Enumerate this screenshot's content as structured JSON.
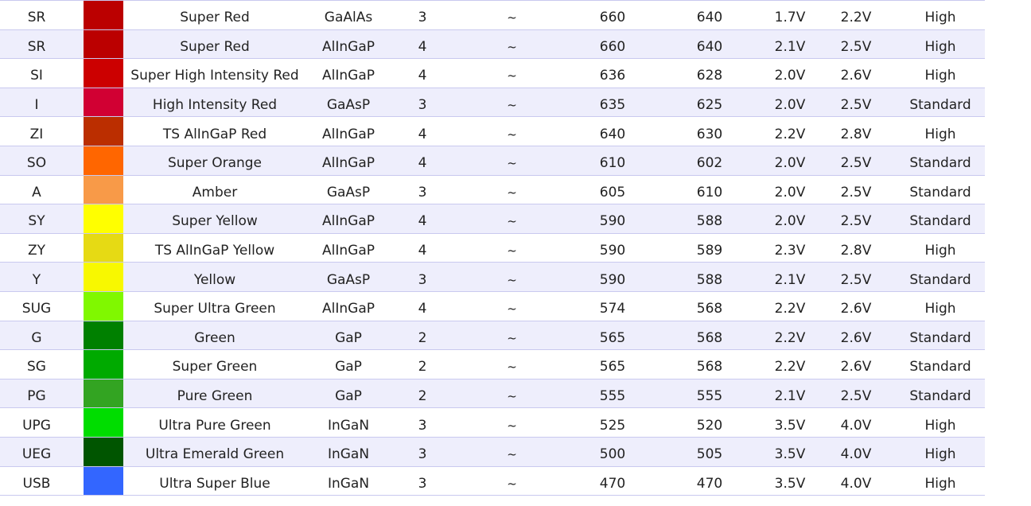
{
  "table": {
    "rows": [
      {
        "code": "SR",
        "color": "#bb0000",
        "name": "Super Red",
        "material": "GaAlAs",
        "size": "3",
        "angle": "~",
        "peak_nm": "660",
        "dominant_nm": "640",
        "vf_typ": "1.7V",
        "vf_max": "2.2V",
        "intensity": "High"
      },
      {
        "code": "SR",
        "color": "#bb0000",
        "name": "Super Red",
        "material": "AlInGaP",
        "size": "4",
        "angle": "~",
        "peak_nm": "660",
        "dominant_nm": "640",
        "vf_typ": "2.1V",
        "vf_max": "2.5V",
        "intensity": "High"
      },
      {
        "code": "SI",
        "color": "#cc0000",
        "name": "Super High Intensity Red",
        "material": "AlInGaP",
        "size": "4",
        "angle": "~",
        "peak_nm": "636",
        "dominant_nm": "628",
        "vf_typ": "2.0V",
        "vf_max": "2.6V",
        "intensity": "High"
      },
      {
        "code": "I",
        "color": "#d10033",
        "name": "High Intensity Red",
        "material": "GaAsP",
        "size": "3",
        "angle": "~",
        "peak_nm": "635",
        "dominant_nm": "625",
        "vf_typ": "2.0V",
        "vf_max": "2.5V",
        "intensity": "Standard"
      },
      {
        "code": "ZI",
        "color": "#bb2e00",
        "name": "TS AlInGaP Red",
        "material": "AlInGaP",
        "size": "4",
        "angle": "~",
        "peak_nm": "640",
        "dominant_nm": "630",
        "vf_typ": "2.2V",
        "vf_max": "2.8V",
        "intensity": "High"
      },
      {
        "code": "SO",
        "color": "#ff6600",
        "name": "Super Orange",
        "material": "AlInGaP",
        "size": "4",
        "angle": "~",
        "peak_nm": "610",
        "dominant_nm": "602",
        "vf_typ": "2.0V",
        "vf_max": "2.5V",
        "intensity": "Standard"
      },
      {
        "code": "A",
        "color": "#f89a48",
        "name": "Amber",
        "material": "GaAsP",
        "size": "3",
        "angle": "~",
        "peak_nm": "605",
        "dominant_nm": "610",
        "vf_typ": "2.0V",
        "vf_max": "2.5V",
        "intensity": "Standard"
      },
      {
        "code": "SY",
        "color": "#ffff00",
        "name": "Super Yellow",
        "material": "AlInGaP",
        "size": "4",
        "angle": "~",
        "peak_nm": "590",
        "dominant_nm": "588",
        "vf_typ": "2.0V",
        "vf_max": "2.5V",
        "intensity": "Standard"
      },
      {
        "code": "ZY",
        "color": "#e6da14",
        "name": "TS AlInGaP Yellow",
        "material": "AlInGaP",
        "size": "4",
        "angle": "~",
        "peak_nm": "590",
        "dominant_nm": "589",
        "vf_typ": "2.3V",
        "vf_max": "2.8V",
        "intensity": "High"
      },
      {
        "code": "Y",
        "color": "#f8f800",
        "name": "Yellow",
        "material": "GaAsP",
        "size": "3",
        "angle": "~",
        "peak_nm": "590",
        "dominant_nm": "588",
        "vf_typ": "2.1V",
        "vf_max": "2.5V",
        "intensity": "Standard"
      },
      {
        "code": "SUG",
        "color": "#80f800",
        "name": "Super Ultra Green",
        "material": "AlInGaP",
        "size": "4",
        "angle": "~",
        "peak_nm": "574",
        "dominant_nm": "568",
        "vf_typ": "2.2V",
        "vf_max": "2.6V",
        "intensity": "High"
      },
      {
        "code": "G",
        "color": "#008000",
        "name": "Green",
        "material": "GaP",
        "size": "2",
        "angle": "~",
        "peak_nm": "565",
        "dominant_nm": "568",
        "vf_typ": "2.2V",
        "vf_max": "2.6V",
        "intensity": "Standard"
      },
      {
        "code": "SG",
        "color": "#00aa00",
        "name": "Super Green",
        "material": "GaP",
        "size": "2",
        "angle": "~",
        "peak_nm": "565",
        "dominant_nm": "568",
        "vf_typ": "2.2V",
        "vf_max": "2.6V",
        "intensity": "Standard"
      },
      {
        "code": "PG",
        "color": "#33a422",
        "name": "Pure Green",
        "material": "GaP",
        "size": "2",
        "angle": "~",
        "peak_nm": "555",
        "dominant_nm": "555",
        "vf_typ": "2.1V",
        "vf_max": "2.5V",
        "intensity": "Standard"
      },
      {
        "code": "UPG",
        "color": "#00dd00",
        "name": "Ultra Pure Green",
        "material": "InGaN",
        "size": "3",
        "angle": "~",
        "peak_nm": "525",
        "dominant_nm": "520",
        "vf_typ": "3.5V",
        "vf_max": "4.0V",
        "intensity": "High"
      },
      {
        "code": "UEG",
        "color": "#005500",
        "name": "Ultra Emerald Green",
        "material": "InGaN",
        "size": "3",
        "angle": "~",
        "peak_nm": "500",
        "dominant_nm": "505",
        "vf_typ": "3.5V",
        "vf_max": "4.0V",
        "intensity": "High"
      },
      {
        "code": "USB",
        "color": "#3366ff",
        "name": "Ultra Super Blue",
        "material": "InGaN",
        "size": "3",
        "angle": "~",
        "peak_nm": "470",
        "dominant_nm": "470",
        "vf_typ": "3.5V",
        "vf_max": "4.0V",
        "intensity": "High"
      }
    ]
  }
}
